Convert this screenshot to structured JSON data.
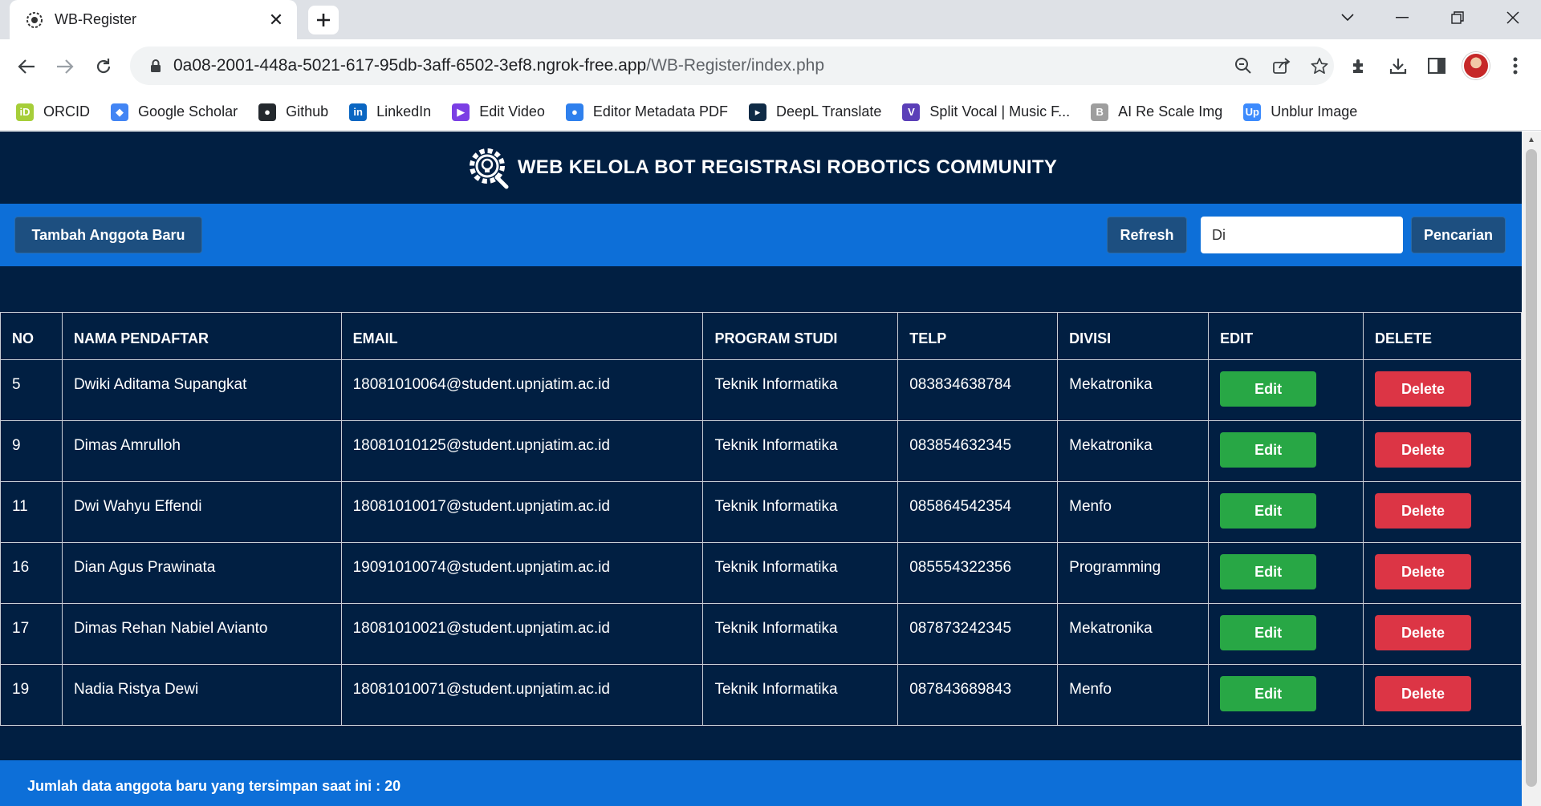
{
  "browser": {
    "tab_title": "WB-Register",
    "url_host": "0a08-2001-448a-5021-617-95db-3aff-6502-3ef8.ngrok-free.app",
    "url_path": "/WB-Register/index.php",
    "bookmarks": [
      {
        "label": "ORCID",
        "icon": "orcid-icon",
        "color": "#a6ce39",
        "glyph": "iD"
      },
      {
        "label": "Google Scholar",
        "icon": "google-scholar-icon",
        "color": "#4285f4",
        "glyph": "◆"
      },
      {
        "label": "Github",
        "icon": "github-icon",
        "color": "#24292e",
        "glyph": "●"
      },
      {
        "label": "LinkedIn",
        "icon": "linkedin-icon",
        "color": "#0a66c2",
        "glyph": "in"
      },
      {
        "label": "Edit Video",
        "icon": "video-icon",
        "color": "#7b3fe4",
        "glyph": "▶"
      },
      {
        "label": "Editor Metadata PDF",
        "icon": "people-icon",
        "color": "#2f80ed",
        "glyph": "●"
      },
      {
        "label": "DeepL Translate",
        "icon": "deepl-icon",
        "color": "#0f2b46",
        "glyph": "▸"
      },
      {
        "label": "Split Vocal | Music F...",
        "icon": "vocal-icon",
        "color": "#5b3fb8",
        "glyph": "V"
      },
      {
        "label": "AI Re Scale Img",
        "icon": "rescale-icon",
        "color": "#9e9e9e",
        "glyph": "B"
      },
      {
        "label": "Unblur Image",
        "icon": "unblur-icon",
        "color": "#3d8bfd",
        "glyph": "Up"
      }
    ]
  },
  "page": {
    "title": "WEB KELOLA BOT REGISTRASI ROBOTICS COMMUNITY",
    "add_button": "Tambah Anggota Baru",
    "refresh_button": "Refresh",
    "search_value": "Di",
    "search_button": "Pencarian",
    "columns": [
      "NO",
      "NAMA PENDAFTAR",
      "EMAIL",
      "PROGRAM STUDI",
      "TELP",
      "DIVISI",
      "EDIT",
      "DELETE"
    ],
    "edit_label": "Edit",
    "delete_label": "Delete",
    "rows": [
      {
        "no": "5",
        "nama": "Dwiki Aditama Supangkat",
        "email": "18081010064@student.upnjatim.ac.id",
        "prodi": "Teknik Informatika",
        "telp": "083834638784",
        "divisi": "Mekatronika"
      },
      {
        "no": "9",
        "nama": "Dimas Amrulloh",
        "email": "18081010125@student.upnjatim.ac.id",
        "prodi": "Teknik Informatika",
        "telp": "083854632345",
        "divisi": "Mekatronika"
      },
      {
        "no": "11",
        "nama": "Dwi Wahyu Effendi",
        "email": "18081010017@student.upnjatim.ac.id",
        "prodi": "Teknik Informatika",
        "telp": "085864542354",
        "divisi": "Menfo"
      },
      {
        "no": "16",
        "nama": "Dian Agus Prawinata",
        "email": "19091010074@student.upnjatim.ac.id",
        "prodi": "Teknik Informatika",
        "telp": "085554322356",
        "divisi": "Programming"
      },
      {
        "no": "17",
        "nama": "Dimas Rehan Nabiel Avianto",
        "email": "18081010021@student.upnjatim.ac.id",
        "prodi": "Teknik Informatika",
        "telp": "087873242345",
        "divisi": "Mekatronika"
      },
      {
        "no": "19",
        "nama": "Nadia Ristya Dewi",
        "email": "18081010071@student.upnjatim.ac.id",
        "prodi": "Teknik Informatika",
        "telp": "087843689843",
        "divisi": "Menfo"
      }
    ],
    "footer_text": "Jumlah data anggota baru yang tersimpan saat ini : 20"
  },
  "colors": {
    "page_bg": "#011f42",
    "bar_blue": "#0d6fd8",
    "button_dark": "#1d4f80",
    "edit_green": "#28a745",
    "delete_red": "#dc3545"
  }
}
